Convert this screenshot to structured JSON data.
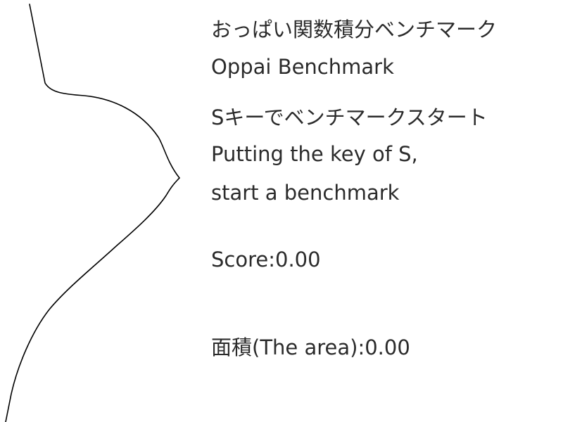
{
  "title_jp": "おっぱい関数積分ベンチマーク",
  "title_en": "Oppai Benchmark",
  "instruction_jp": "Sキーでベンチマークスタート",
  "instruction_en_line1": "Putting the key of S,",
  "instruction_en_line2": "start a benchmark",
  "score_text": "Score:0.00",
  "area_text": "面積(The area):0.00"
}
